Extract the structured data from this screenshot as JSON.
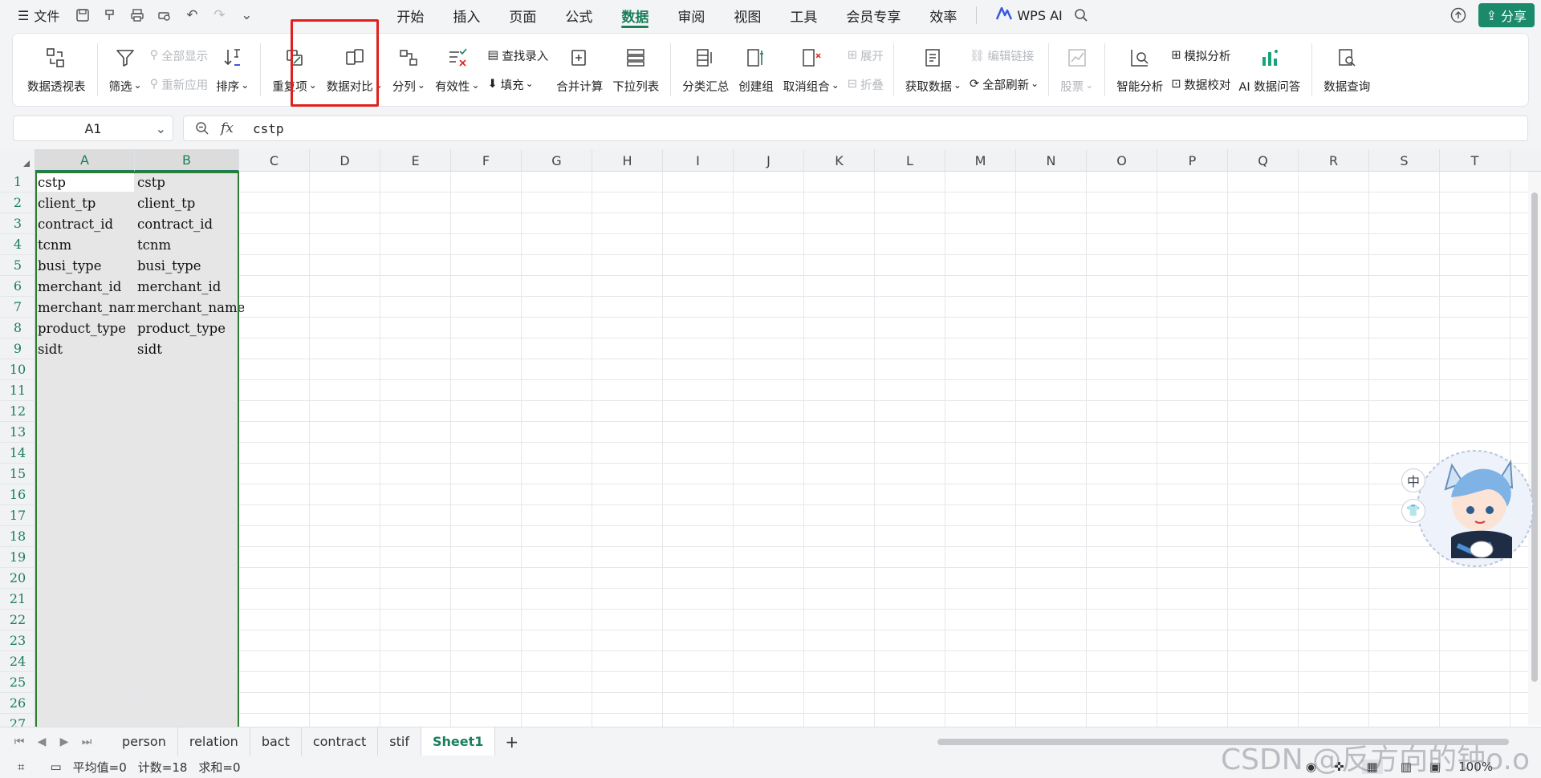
{
  "menu": {
    "file_label": "文件",
    "tabs": [
      "开始",
      "插入",
      "页面",
      "公式",
      "数据",
      "审阅",
      "视图",
      "工具",
      "会员专享",
      "效率"
    ],
    "active_tab": "数据",
    "wps_ai": "WPS AI",
    "share": "分享"
  },
  "ribbon": {
    "pivot": "数据透视表",
    "filter": "筛选",
    "show_all": "全部显示",
    "reapply": "重新应用",
    "sort": "排序",
    "duplicates": "重复项",
    "compare": "数据对比",
    "split": "分列",
    "validity": "有效性",
    "find_entry": "查找录入",
    "fill": "填充",
    "consolidate": "合并计算",
    "dropdown_list": "下拉列表",
    "subtotal": "分类汇总",
    "group": "创建组",
    "ungroup": "取消组合",
    "expand": "展开",
    "collapse": "折叠",
    "get_data": "获取数据",
    "edit_links": "编辑链接",
    "refresh_all": "全部刷新",
    "stocks": "股票",
    "smart_analysis": "智能分析",
    "simulate": "模拟分析",
    "data_check": "数据校对",
    "ai_qa": "AI 数据问答",
    "data_query": "数据查询"
  },
  "formula_bar": {
    "cell_ref": "A1",
    "fx": "fx",
    "value": "cstp"
  },
  "columns": [
    "A",
    "B",
    "C",
    "D",
    "E",
    "F",
    "G",
    "H",
    "I",
    "J",
    "K",
    "L",
    "M",
    "N",
    "O",
    "P",
    "Q",
    "R",
    "S",
    "T"
  ],
  "rows": [
    "1",
    "2",
    "3",
    "4",
    "5",
    "6",
    "7",
    "8",
    "9",
    "10",
    "11",
    "12",
    "13",
    "14",
    "15",
    "16",
    "17",
    "18",
    "19",
    "20",
    "21",
    "22",
    "23",
    "24",
    "25",
    "26",
    "27"
  ],
  "cells_a": [
    "cstp",
    "client_tp",
    "contract_id",
    "tcnm",
    "busi_type",
    "merchant_id",
    "merchant_nam",
    "product_type",
    "sidt"
  ],
  "cells_b": [
    "cstp",
    "client_tp",
    "contract_id",
    "tcnm",
    "busi_type",
    "merchant_id",
    "merchant_name",
    "product_type",
    "sidt"
  ],
  "sheets": [
    "person",
    "relation",
    "bact",
    "contract",
    "stif",
    "Sheet1"
  ],
  "active_sheet": "Sheet1",
  "status": {
    "average": "平均值=0",
    "count": "计数=18",
    "sum": "求和=0",
    "zoom": "100%"
  },
  "watermark": "CSDN @反方向的钟o.o",
  "mascot_label": "中",
  "colors": {
    "accent": "#1a7f5a",
    "highlight": "#e02020",
    "selection": "#2e7d32"
  }
}
